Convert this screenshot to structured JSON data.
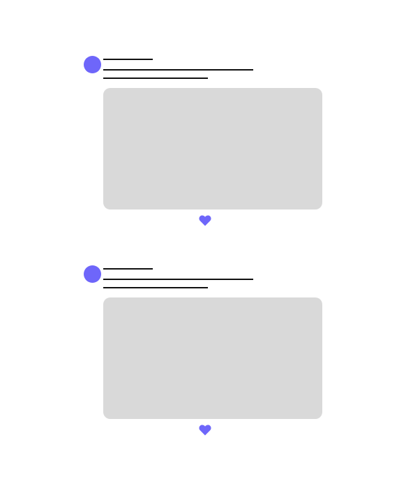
{
  "theme": {
    "accent_color": "#6e66fa",
    "placeholder_color": "#d9d9d9",
    "text_line_color": "#111111"
  },
  "posts": [
    {
      "avatar_icon": "avatar-icon",
      "media": "image-placeholder",
      "like_icon": "heart-icon"
    },
    {
      "avatar_icon": "avatar-icon",
      "media": "image-placeholder",
      "like_icon": "heart-icon"
    }
  ]
}
